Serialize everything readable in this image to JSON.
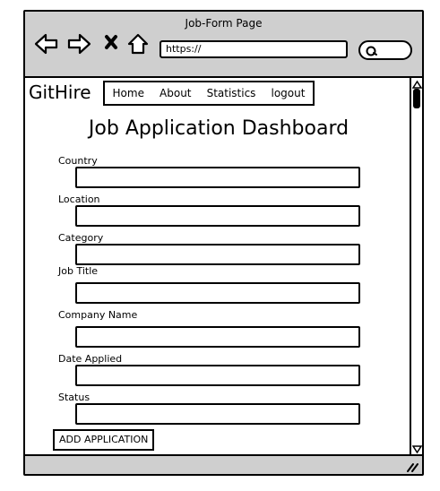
{
  "window": {
    "title": "Job-Form Page"
  },
  "browser": {
    "url": "https://"
  },
  "nav": {
    "brand": "GitHire",
    "items": [
      "Home",
      "About",
      "Statistics",
      "logout"
    ]
  },
  "page": {
    "title": "Job Application Dashboard"
  },
  "form": {
    "fields": [
      {
        "label": "Country",
        "value": ""
      },
      {
        "label": "Location",
        "value": ""
      },
      {
        "label": "Category",
        "value": ""
      },
      {
        "label": "Job Title",
        "value": ""
      },
      {
        "label": "Company Name",
        "value": ""
      },
      {
        "label": "Date Applied",
        "value": ""
      },
      {
        "label": "Status",
        "value": ""
      }
    ],
    "submit_label": "ADD APPLICATION"
  },
  "icons": [
    "back-arrow-icon",
    "forward-arrow-icon",
    "close-icon",
    "home-icon",
    "search-icon",
    "resize-grip-icon"
  ],
  "colors": {
    "chrome": "#cfcfcf",
    "border": "#000000",
    "background": "#ffffff"
  }
}
